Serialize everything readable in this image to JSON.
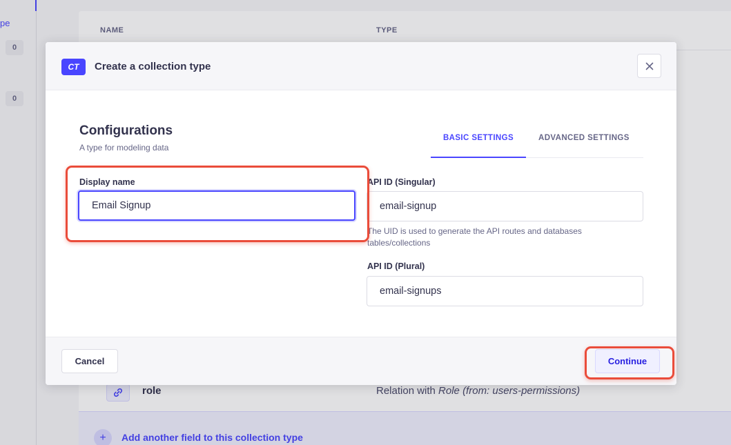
{
  "background": {
    "side_nav": {
      "partial_text": "pe",
      "badges": [
        "0",
        "0"
      ]
    },
    "table": {
      "headers": [
        "NAME",
        "TYPE"
      ],
      "rows": [
        {
          "name": "role",
          "type_prefix": "Relation with ",
          "type_italic": "Role (from: users-permissions)"
        }
      ],
      "add_field_label": "Add another field to this collection type"
    }
  },
  "modal": {
    "badge": "CT",
    "title": "Create a collection type",
    "close_icon": "close-icon",
    "section_title": "Configurations",
    "section_subtitle": "A type for modeling data",
    "tabs": [
      {
        "label": "BASIC SETTINGS",
        "active": true
      },
      {
        "label": "ADVANCED SETTINGS",
        "active": false
      }
    ],
    "fields": {
      "display_name": {
        "label": "Display name",
        "value": "Email Signup"
      },
      "api_singular": {
        "label": "API ID (Singular)",
        "value": "email-signup",
        "hint": "The UID is used to generate the API routes and databases tables/collections"
      },
      "api_plural": {
        "label": "API ID (Plural)",
        "value": "email-signups"
      }
    },
    "footer": {
      "cancel_label": "Cancel",
      "continue_label": "Continue"
    }
  },
  "colors": {
    "primary": "#4945ff",
    "highlight": "#ea4c3a",
    "text": "#32324d",
    "muted": "#666687"
  }
}
